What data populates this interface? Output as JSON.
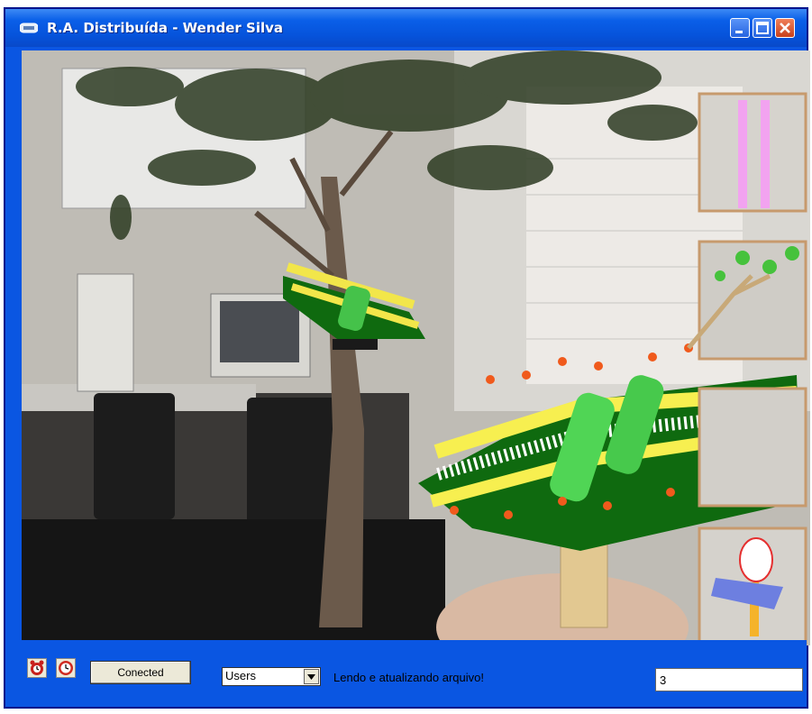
{
  "window": {
    "title": "R.A. Distribuída - Wender Silva",
    "minimize_icon": "minimize-icon",
    "maximize_icon": "maximize-icon",
    "close_icon": "close-icon"
  },
  "toolbar": {
    "alarm_icon": "alarm-clock-icon",
    "clock_icon": "clock-icon",
    "connect_label": "Conected",
    "users_select": "Users",
    "status_text": "Lendo e atualizando arquivo!",
    "count_value": "3"
  },
  "colors": {
    "title_bar": "#0a56e2",
    "close_button": "#d8542c",
    "membrane_green": "#0f6a0f",
    "marker_frame": "#c79a6d"
  }
}
